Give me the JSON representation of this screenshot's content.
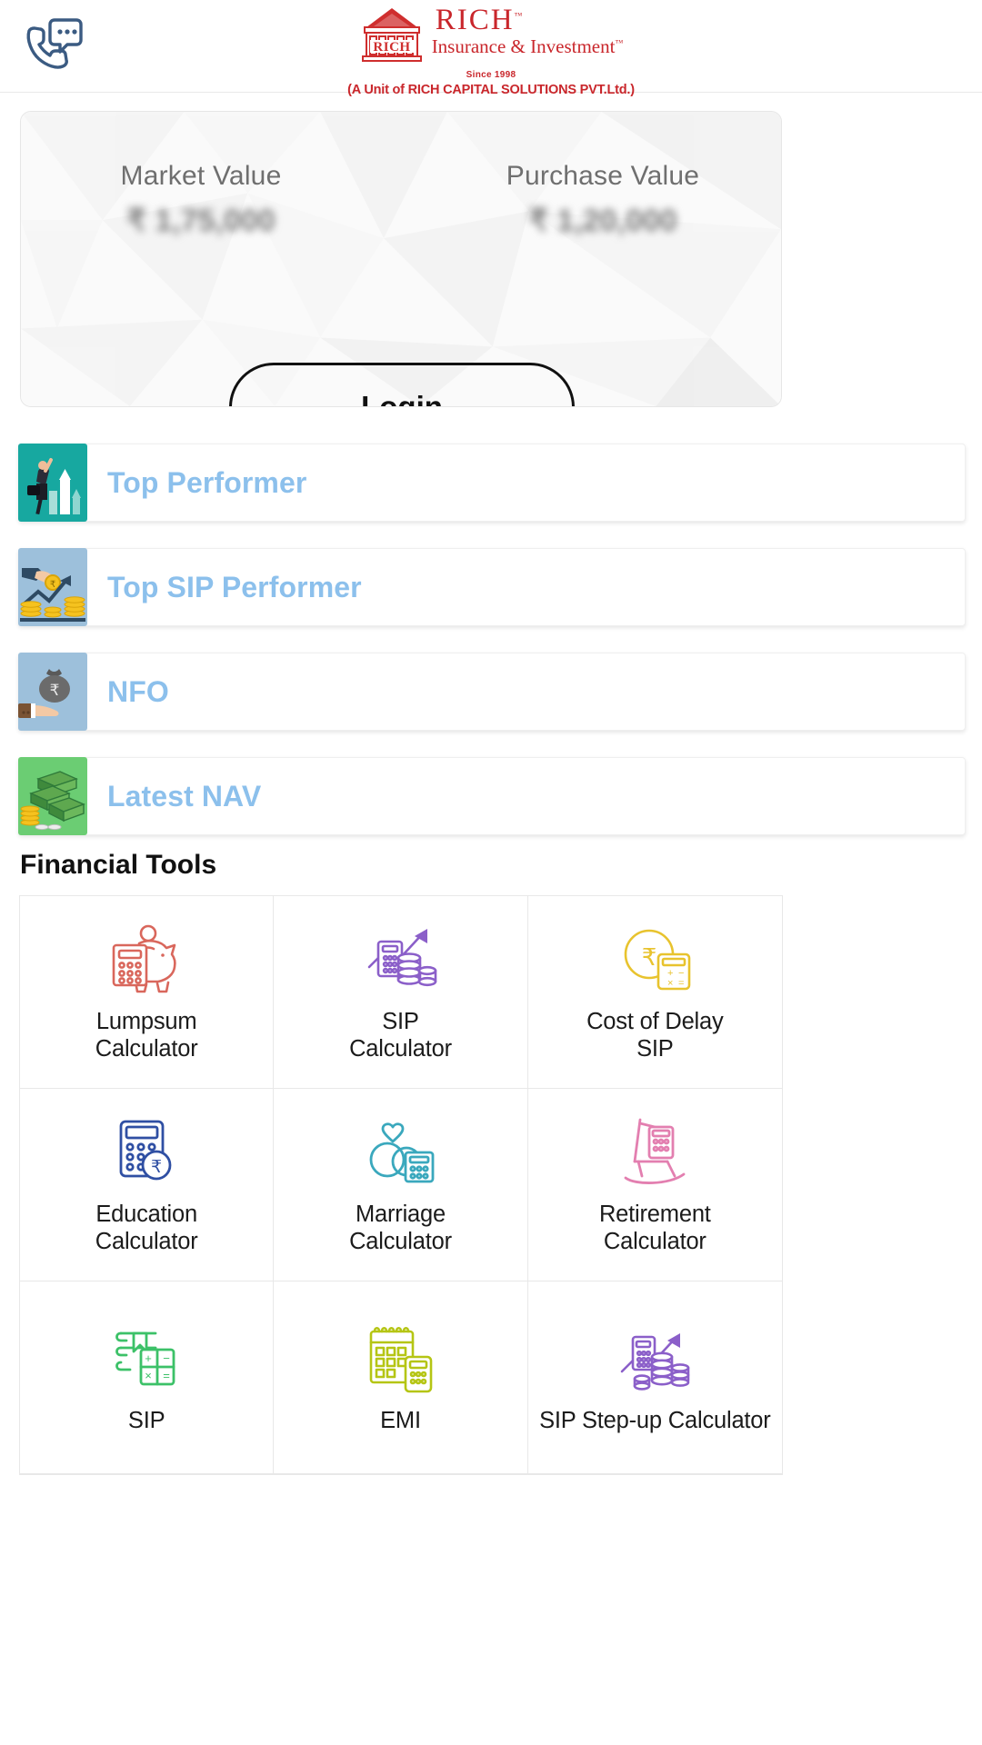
{
  "header": {
    "support_icon": "phone-chat-support-icon",
    "brand_name": "RICH",
    "brand_tagline": "Insurance & Investment",
    "brand_since": "Since 1998",
    "brand_unit": "(A Unit of RICH CAPITAL SOLUTIONS PVT.Ltd.)",
    "trademark": "™",
    "brand_color": "#c9262b"
  },
  "portfolio": {
    "market_value_label": "Market Value",
    "market_value": "₹ 1,75,000",
    "purchase_value_label": "Purchase Value",
    "purchase_value": "₹ 1,20,000",
    "login_label": "Login"
  },
  "menu": {
    "items": [
      {
        "label": "Top Performer",
        "icon": "businessman-growth-chart-icon",
        "tile_color": "#17a8a0"
      },
      {
        "label": "Top SIP Performer",
        "icon": "hand-coin-growth-arrow-icon",
        "tile_color": "#9dc0db"
      },
      {
        "label": "NFO",
        "icon": "hand-money-bag-rupee-icon",
        "tile_color": "#9dc0db"
      },
      {
        "label": "Latest NAV",
        "icon": "cash-stacks-coins-icon",
        "tile_color": "#6bcd73"
      }
    ],
    "label_color": "#8cc0ec"
  },
  "tools": {
    "heading": "Financial Tools",
    "items": [
      {
        "label": "Lumpsum\nCalculator",
        "line1": "Lumpsum",
        "line2": "Calculator",
        "icon": "piggy-bank-calculator-icon",
        "color": "#d9675c"
      },
      {
        "label": "SIP\nCalculator",
        "line1": "SIP",
        "line2": "Calculator",
        "icon": "calculator-coins-arrow-icon",
        "color": "#8b5fc9"
      },
      {
        "label": "Cost of Delay\nSIP",
        "line1": "Cost of Delay",
        "line2": "SIP",
        "icon": "rupee-clock-calculator-icon",
        "color": "#e8c32e"
      },
      {
        "label": "Education\nCalculator",
        "line1": "Education",
        "line2": "Calculator",
        "icon": "calculator-rupee-coin-icon",
        "color": "#2f4fa3"
      },
      {
        "label": "Marriage\nCalculator",
        "line1": "Marriage",
        "line2": "Calculator",
        "icon": "wedding-rings-calculator-icon",
        "color": "#3aa8bd"
      },
      {
        "label": "Retirement\nCalculator",
        "line1": "Retirement",
        "line2": "Calculator",
        "icon": "rocking-chair-calculator-icon",
        "color": "#e37fb0"
      },
      {
        "label": "SIP",
        "line1": "SIP",
        "line2": "",
        "icon": "book-calculator-icon",
        "color": "#3cc168"
      },
      {
        "label": "EMI",
        "line1": "EMI",
        "line2": "",
        "icon": "calendar-calculator-icon",
        "color": "#b5c514"
      },
      {
        "label": "SIP Step-up Calculator",
        "line1": "SIP Step-up Calculator",
        "line2": "",
        "icon": "calculator-coin-stack-arrow-icon",
        "color": "#8b5fc9"
      }
    ]
  }
}
